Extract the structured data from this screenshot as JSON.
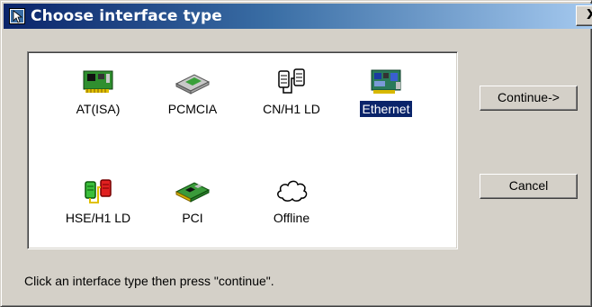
{
  "window": {
    "title": "Choose interface type",
    "close_glyph": "X"
  },
  "interfaces": [
    {
      "label": "AT(ISA)",
      "icon": "isa-card-icon",
      "selected": false
    },
    {
      "label": "PCMCIA",
      "icon": "pcmcia-card-icon",
      "selected": false
    },
    {
      "label": "CN/H1 LD",
      "icon": "linking-device-icon",
      "selected": false
    },
    {
      "label": "Ethernet",
      "icon": "ethernet-card-icon",
      "selected": true
    },
    {
      "label": "HSE/H1 LD",
      "icon": "hse-linking-device-icon",
      "selected": false
    },
    {
      "label": "PCI",
      "icon": "pci-card-icon",
      "selected": false
    },
    {
      "label": "Offline",
      "icon": "cloud-icon",
      "selected": false
    }
  ],
  "buttons": {
    "continue": "Continue->",
    "cancel": "Cancel"
  },
  "status": "Click an interface type then press \"continue\".",
  "colors": {
    "title_gradient_start": "#0a246a",
    "title_gradient_end": "#a6caf0",
    "selection": "#0a246a",
    "face": "#d4d0c8"
  }
}
